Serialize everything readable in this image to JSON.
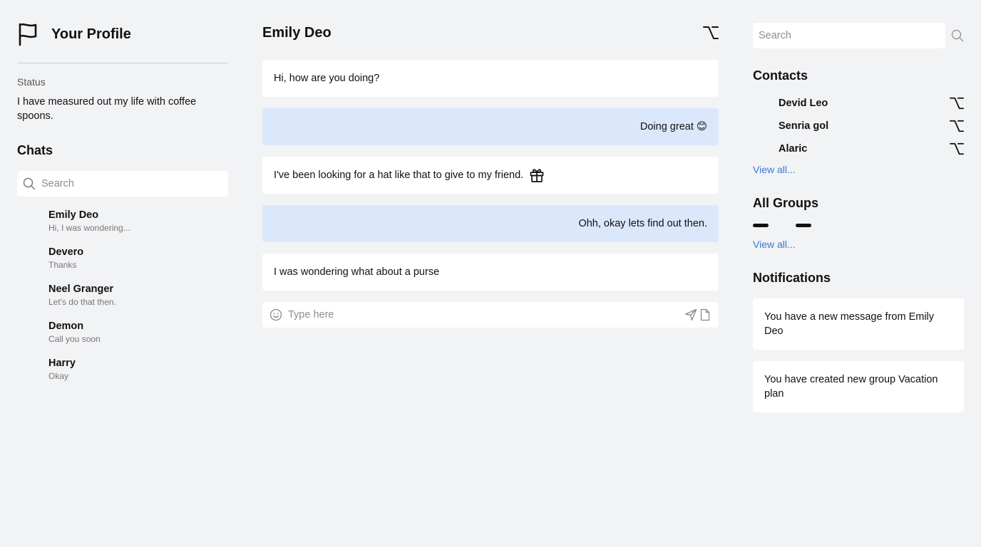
{
  "profile": {
    "title": "Your Profile",
    "status_label": "Status",
    "status_text": "I have measured out my life with coffee spoons."
  },
  "chats": {
    "title": "Chats",
    "search_placeholder": "Search",
    "items": [
      {
        "name": "Emily Deo",
        "preview": "Hi, I was wondering..."
      },
      {
        "name": "Devero",
        "preview": "Thanks"
      },
      {
        "name": "Neel Granger",
        "preview": "Let's do that then."
      },
      {
        "name": "Demon",
        "preview": "Call you soon"
      },
      {
        "name": "Harry",
        "preview": "Okay"
      }
    ]
  },
  "conversation": {
    "title": "Emily Deo",
    "messages": [
      {
        "text": "Hi, how are you doing?",
        "from": "them"
      },
      {
        "text": "Doing great 😊",
        "from": "me"
      },
      {
        "text": "I've been looking for a hat like that to give to my friend.",
        "from": "them",
        "icon": "gift-icon"
      },
      {
        "text": "Ohh, okay lets find out then.",
        "from": "me"
      },
      {
        "text": "I was wondering what about a purse",
        "from": "them"
      }
    ],
    "composer_placeholder": "Type here"
  },
  "sidebar": {
    "search_placeholder": "Search",
    "contacts_title": "Contacts",
    "contacts": [
      {
        "name": "Devid Leo"
      },
      {
        "name": "Senria gol"
      },
      {
        "name": "Alaric"
      }
    ],
    "contacts_view_all": "View all...",
    "groups_title": "All Groups",
    "groups_view_all": "View all...",
    "notifications_title": "Notifications",
    "notifications": [
      {
        "text": "You have a new message from Emily Deo"
      },
      {
        "text": "You have created new group Vacation plan"
      }
    ]
  },
  "colors": {
    "background": "#f2f3f5",
    "card": "#ffffff",
    "own_message": "#dbe8fb",
    "link": "#3b76d8"
  }
}
